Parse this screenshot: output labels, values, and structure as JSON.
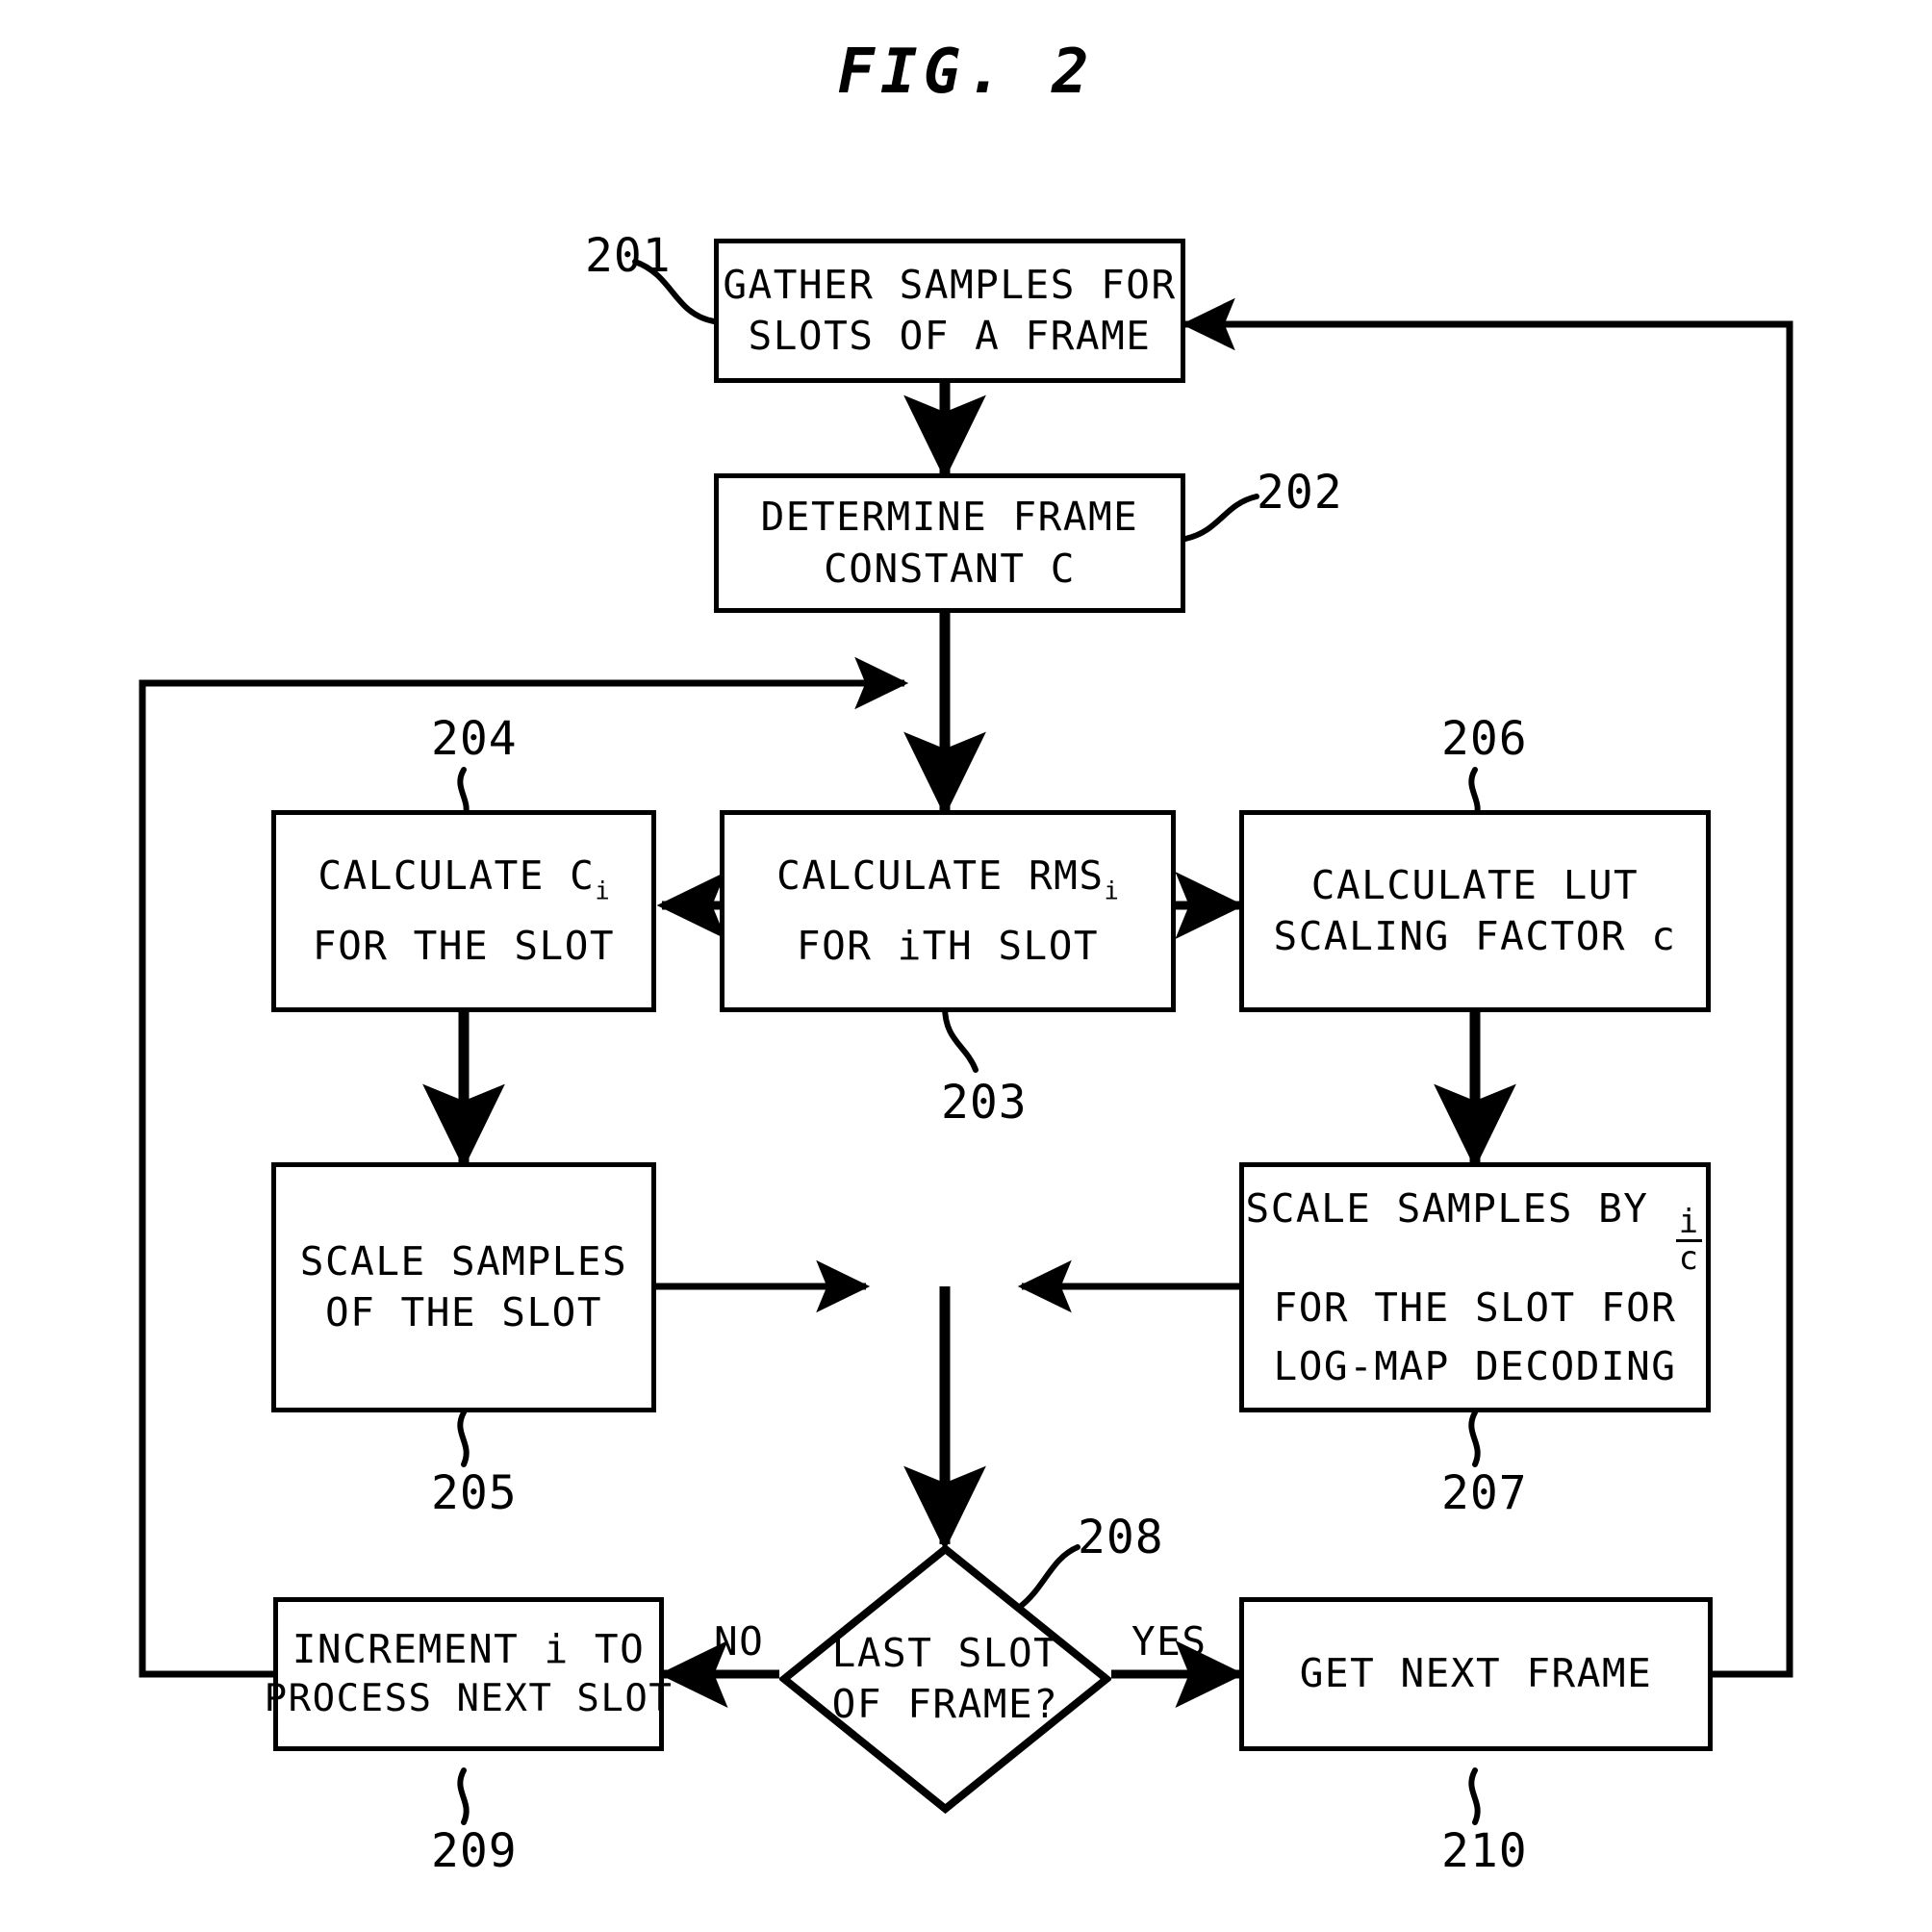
{
  "figure": {
    "title": "FIG. 2",
    "type": "patent-flowchart",
    "ink_color": "#000000",
    "background_color": "#ffffff"
  },
  "nodes": {
    "n201": {
      "ref": "201",
      "shape": "process",
      "lines": [
        "GATHER SAMPLES FOR",
        "SLOTS OF A FRAME"
      ]
    },
    "n202": {
      "ref": "202",
      "shape": "process",
      "lines": [
        "DETERMINE FRAME",
        "CONSTANT C"
      ]
    },
    "n203": {
      "ref": "203",
      "shape": "process",
      "line1_prefix": "CALCULATE RMS",
      "line1_sub": "i",
      "line2": "FOR iTH SLOT",
      "lines": [
        "CALCULATE RMSi",
        "FOR iTH SLOT"
      ]
    },
    "n204": {
      "ref": "204",
      "shape": "process",
      "line1_prefix": "CALCULATE C",
      "line1_sub": "i",
      "line2": "FOR THE SLOT",
      "lines": [
        "CALCULATE Ci",
        "FOR THE SLOT"
      ]
    },
    "n205": {
      "ref": "205",
      "shape": "process",
      "lines": [
        "SCALE SAMPLES",
        "OF THE SLOT"
      ]
    },
    "n206": {
      "ref": "206",
      "shape": "process",
      "lines": [
        "CALCULATE LUT",
        "SCALING FACTOR c"
      ]
    },
    "n207": {
      "ref": "207",
      "shape": "process",
      "line1_prefix": "SCALE SAMPLES BY ",
      "frac_num": "i",
      "frac_den": "c",
      "line2": "FOR THE SLOT FOR",
      "line3": "LOG-MAP DECODING",
      "lines": [
        "SCALE SAMPLES BY i/c",
        "FOR THE SLOT FOR",
        "LOG-MAP DECODING"
      ]
    },
    "n208": {
      "ref": "208",
      "shape": "decision",
      "lines": [
        "LAST SLOT",
        "OF FRAME?"
      ]
    },
    "n209": {
      "ref": "209",
      "shape": "process",
      "lines": [
        "INCREMENT i TO",
        "PROCESS NEXT SLOT"
      ]
    },
    "n210": {
      "ref": "210",
      "shape": "process",
      "lines": [
        "GET NEXT FRAME"
      ]
    }
  },
  "branch_labels": {
    "no": "NO",
    "yes": "YES"
  },
  "edges": [
    {
      "from": "201",
      "to": "202",
      "label": ""
    },
    {
      "from": "202",
      "to": "203",
      "label": ""
    },
    {
      "from": "203",
      "to": "204",
      "label": ""
    },
    {
      "from": "203",
      "to": "206",
      "label": ""
    },
    {
      "from": "204",
      "to": "205",
      "label": ""
    },
    {
      "from": "206",
      "to": "207",
      "label": ""
    },
    {
      "from": "205",
      "to": "208",
      "label": ""
    },
    {
      "from": "207",
      "to": "208",
      "label": ""
    },
    {
      "from": "208",
      "to": "209",
      "label": "NO"
    },
    {
      "from": "208",
      "to": "210",
      "label": "YES"
    },
    {
      "from": "209",
      "to": "203",
      "label": ""
    },
    {
      "from": "210",
      "to": "201",
      "label": ""
    }
  ]
}
